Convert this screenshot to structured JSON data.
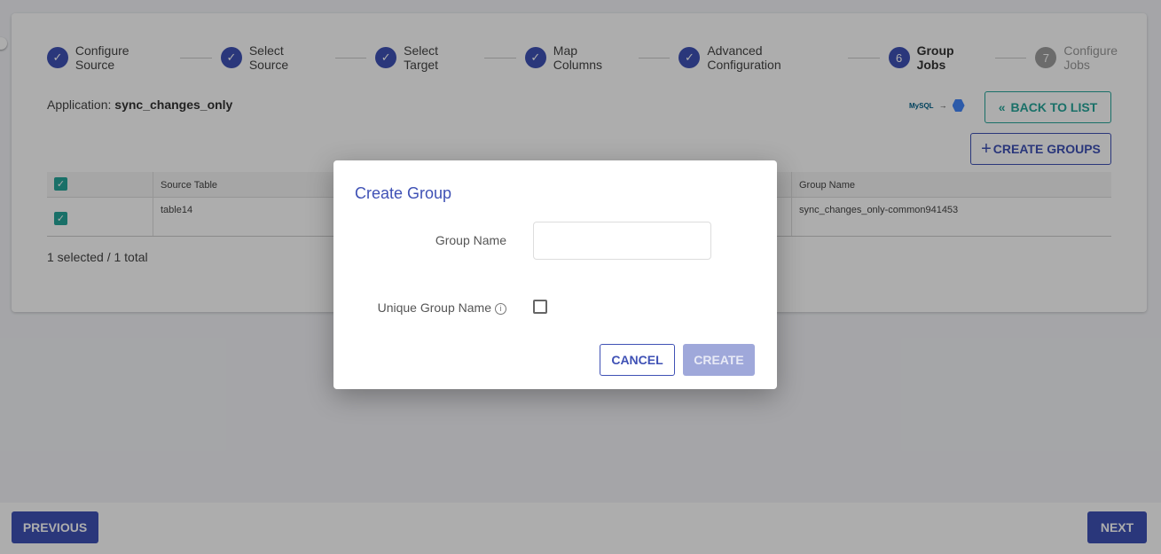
{
  "stepper": {
    "steps": [
      {
        "label": "Configure Source",
        "state": "done"
      },
      {
        "label": "Select Source",
        "state": "done"
      },
      {
        "label": "Select Target",
        "state": "done"
      },
      {
        "label": "Map Columns",
        "state": "done"
      },
      {
        "label": "Advanced Configuration",
        "state": "done"
      },
      {
        "label": "Group Jobs",
        "number": "6",
        "state": "active"
      },
      {
        "label": "Configure Jobs",
        "number": "7",
        "state": "todo"
      }
    ]
  },
  "application": {
    "label": "Application:",
    "name": "sync_changes_only"
  },
  "connection": {
    "source": "MySQL",
    "arrow": "→",
    "target": "BigQuery"
  },
  "buttons": {
    "back_to_list": "BACK TO LIST",
    "create_groups": "CREATE GROUPS",
    "previous": "PREVIOUS",
    "next": "NEXT"
  },
  "table": {
    "headers": [
      "Source Table",
      "Group Name"
    ],
    "rows": [
      {
        "checked": true,
        "source_table": "table14",
        "group_name": "sync_changes_only-common941453"
      }
    ],
    "header_checked": true
  },
  "selection": "1 selected / 1 total",
  "modal": {
    "title": "Create Group",
    "group_name_label": "Group Name",
    "group_name_value": "",
    "unique_label": "Unique Group Name",
    "unique_checked": false,
    "cancel": "CANCEL",
    "create": "CREATE"
  },
  "colors": {
    "primary": "#3f51b5",
    "accent": "#26a69a"
  }
}
